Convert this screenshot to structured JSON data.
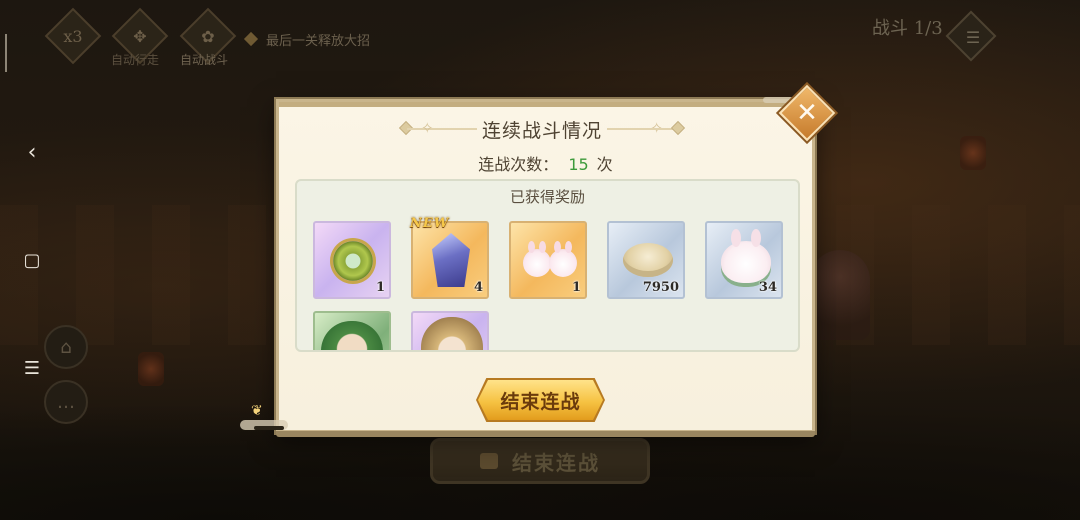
{
  "nav": {
    "back_glyph": "‹",
    "home_glyph": "▢",
    "menu_glyph": "☰"
  },
  "hud": {
    "speed_label": "x3",
    "auto_walk_label": "自动行走",
    "auto_battle_label": "自动战斗",
    "last_stage_tip": "最后一关释放大招",
    "battle_counter": "战斗 1/3",
    "menu_glyph": "☰"
  },
  "dialog": {
    "title": "连续战斗情况",
    "battle_count_label": "连战次数：",
    "battle_count_value": "15",
    "battle_count_unit": "次",
    "rewards_title": "已获得奖励",
    "new_badge": "NEW",
    "end_button_label": "结束连战",
    "close_glyph": "✕"
  },
  "rewards": {
    "items": [
      {
        "icon": "green-ring-icon",
        "count": "1"
      },
      {
        "icon": "blue-crystal-icon",
        "count": "4"
      },
      {
        "icon": "bunny-pair-icon",
        "count": "1"
      },
      {
        "icon": "shell-icon",
        "count": "7950"
      },
      {
        "icon": "bunny-cushion-icon",
        "count": "34"
      },
      {
        "icon": "green-hair-portrait",
        "count": ""
      },
      {
        "icon": "gold-hair-portrait",
        "count": ""
      }
    ]
  },
  "background": {
    "end_button_label": "结束连战"
  },
  "colors": {
    "accent_gold": "#f6c242",
    "count_green": "#3c9a3a",
    "dialog_bg": "#f7f0dd"
  }
}
